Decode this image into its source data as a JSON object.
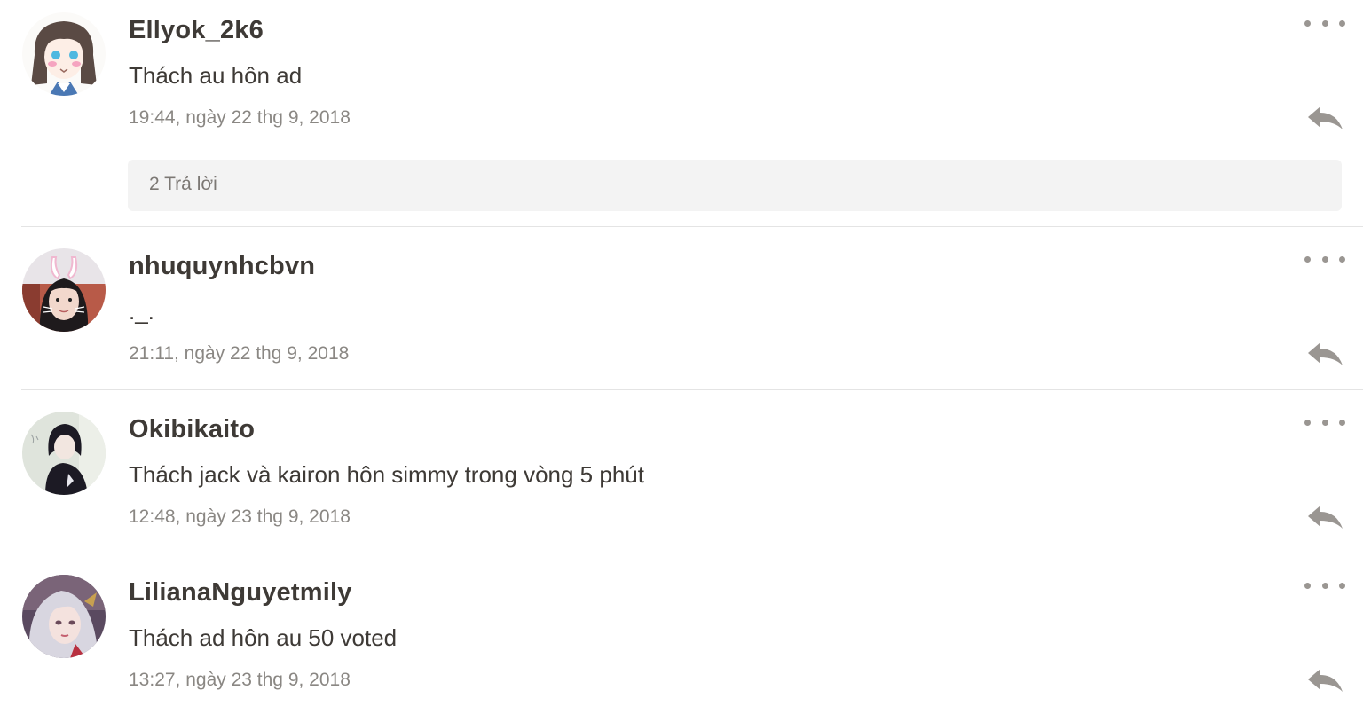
{
  "comments": [
    {
      "username": "Ellyok_2k6",
      "body": "Thách au hôn ad",
      "timestamp": "19:44, ngày 22 thg 9, 2018",
      "replies_label": "2 Trả lời",
      "avatar": "anime-girl-avatar"
    },
    {
      "username": "nhuquynhcbvn",
      "body": "._.",
      "timestamp": "21:11, ngày 22 thg 9, 2018",
      "avatar": "bunny-ears-photo-avatar"
    },
    {
      "username": "Okibikaito",
      "body": "Thách jack và kairon  hôn simmy trong vòng 5 phút",
      "timestamp": "12:48, ngày 23 thg 9, 2018",
      "avatar": "anime-boy-avatar"
    },
    {
      "username": "LilianaNguyetmily",
      "body": "Thách ad hôn au 50 voted",
      "timestamp": "13:27, ngày 23 thg 9, 2018",
      "avatar": "game-character-avatar"
    }
  ],
  "colors": {
    "text": "#3e3a36",
    "meta": "#8a8783",
    "icon": "#9a9692",
    "divider": "#e4e4e4",
    "replies_bg": "#f3f3f3"
  }
}
